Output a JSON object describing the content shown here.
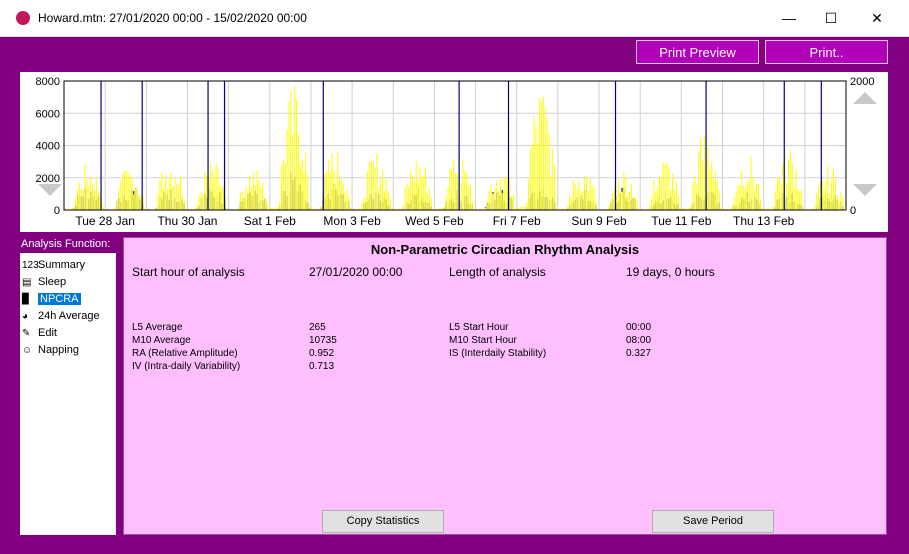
{
  "window": {
    "title": "Howard.mtn: 27/01/2020 00:00 - 15/02/2020 00:00",
    "icon": "moon-app-icon"
  },
  "toolbar": {
    "print_preview": "Print Preview",
    "print": "Print.."
  },
  "chart_data": {
    "type": "bar",
    "ylim_left": [
      0,
      8000
    ],
    "ylim_right": [
      0,
      2000
    ],
    "y_ticks_left": [
      "8000",
      "6000",
      "4000",
      "2000",
      "0"
    ],
    "y_ticks_right": [
      "2000",
      "0"
    ],
    "x_tick_labels": [
      "Tue 28 Jan",
      "Thu 30 Jan",
      "Sat 1 Feb",
      "Mon 3 Feb",
      "Wed 5 Feb",
      "Fri 7 Feb",
      "Sun 9 Feb",
      "Tue 11 Feb",
      "Thu 13 Feb"
    ],
    "days": 19,
    "grid": true,
    "series": [
      {
        "color": "#000000",
        "daily_peak": [
          1700,
          1600,
          1500,
          1500,
          1300,
          2900,
          1700,
          1500,
          1400,
          1500,
          1400,
          1500,
          1600,
          1400,
          1200,
          1500,
          1300,
          1200,
          1100
        ]
      },
      {
        "color": "#ffff00",
        "daily_peak": [
          3000,
          2800,
          3600,
          3100,
          2800,
          8000,
          4000,
          3700,
          3600,
          3800,
          2900,
          8000,
          2800,
          2600,
          3400,
          5200,
          3600,
          4200,
          2800
        ]
      }
    ],
    "sleep_markers_days": [
      0.9,
      1.9,
      3.5,
      3.9,
      6.3,
      9.6,
      10.8,
      13.4,
      15.6,
      17.5,
      18.4
    ],
    "marker_color": "#00008b"
  },
  "analysis": {
    "header": "Analysis Function:",
    "items": [
      {
        "icon": "123",
        "label": "Summary"
      },
      {
        "icon": "bed-icon",
        "label": "Sleep"
      },
      {
        "icon": "bars-icon",
        "label": "NPCRA",
        "selected": true
      },
      {
        "icon": "clock-icon",
        "label": "24h Average"
      },
      {
        "icon": "pencil-icon",
        "label": "Edit"
      },
      {
        "icon": "nap-icon",
        "label": "Napping"
      }
    ]
  },
  "npcra": {
    "title": "Non-Parametric Circadian Rhythm Analysis",
    "start_hour_label": "Start hour of analysis",
    "start_hour_value": "27/01/2020 00:00",
    "length_label": "Length of analysis",
    "length_value": "19 days, 0 hours",
    "l5_avg_label": "L5 Average",
    "l5_avg_value": "265",
    "m10_avg_label": "M10 Average",
    "m10_avg_value": "10735",
    "ra_label": "RA (Relative Amplitude)",
    "ra_value": "0.952",
    "iv_label": "IV (Intra-daily Variability)",
    "iv_value": "0.713",
    "l5_start_label": "L5 Start Hour",
    "l5_start_value": "00:00",
    "m10_start_label": "M10 Start Hour",
    "m10_start_value": "08:00",
    "is_label": "IS (Interdaily Stability)",
    "is_value": "0.327",
    "copy_button": "Copy Statistics",
    "save_button": "Save Period"
  }
}
